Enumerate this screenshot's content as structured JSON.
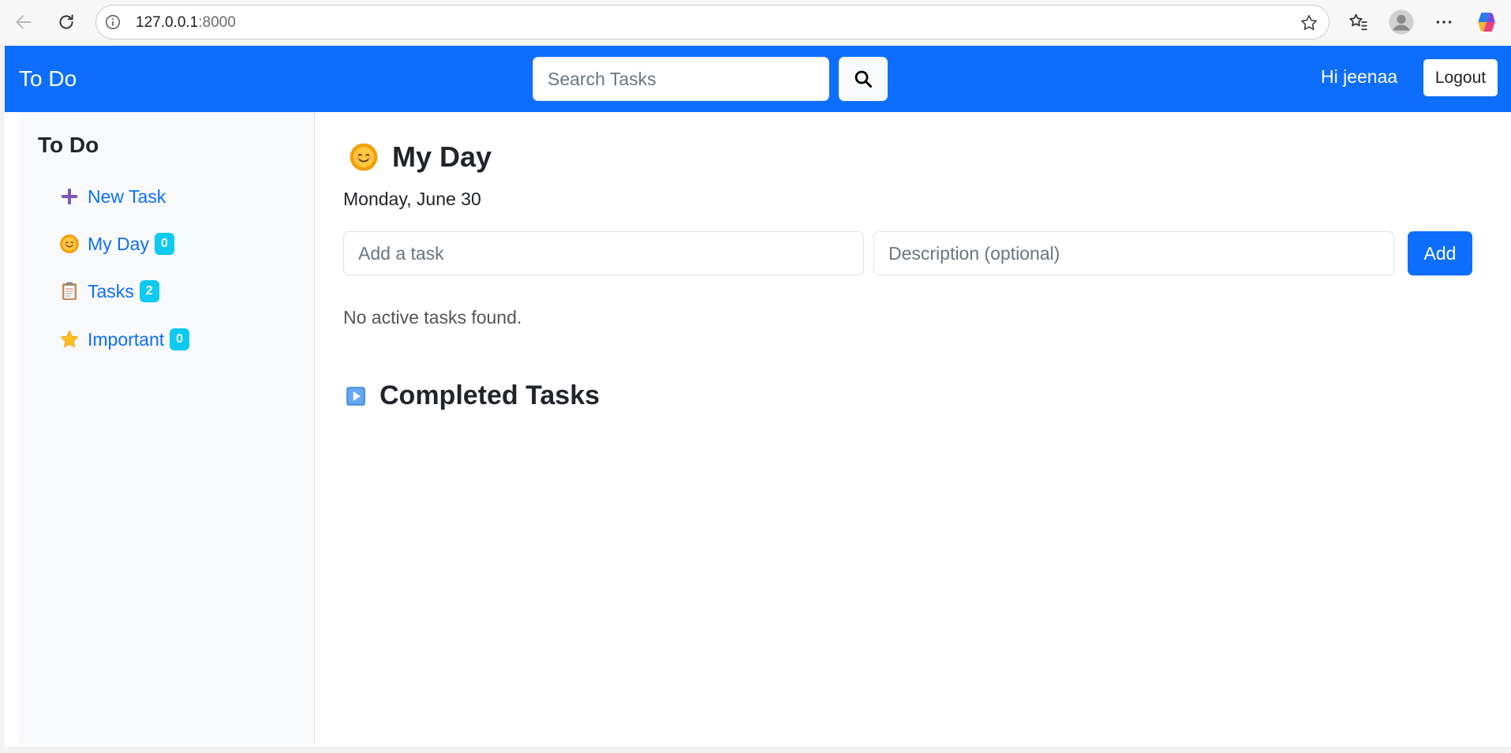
{
  "browser": {
    "url_host": "127.0.0.1",
    "url_port": ":8000",
    "icons": [
      "back-arrow-icon",
      "refresh-icon",
      "info-icon",
      "star-outline-icon",
      "favorites-icon",
      "profile-icon",
      "more-icon",
      "copilot-icon"
    ]
  },
  "navbar": {
    "brand": "To Do",
    "search_placeholder": "Search Tasks",
    "greeting": "Hi jeenaa",
    "logout_label": "Logout",
    "color": "#0d6efd"
  },
  "sidebar": {
    "title": "To Do",
    "items": [
      {
        "label": "New Task",
        "icon": "plus-icon",
        "badge": null
      },
      {
        "label": "My Day",
        "icon": "sun-face-icon",
        "badge": "0"
      },
      {
        "label": "Tasks",
        "icon": "clipboard-icon",
        "badge": "2"
      },
      {
        "label": "Important",
        "icon": "star-icon",
        "badge": "0"
      }
    ]
  },
  "main": {
    "title": "My Day",
    "date": "Monday, June 30",
    "task_placeholder": "Add a task",
    "description_placeholder": "Description (optional)",
    "add_label": "Add",
    "empty_message": "No active tasks found.",
    "completed_title": "Completed Tasks"
  },
  "colors": {
    "primary": "#0d6efd",
    "badge": "#0dcaf0",
    "sidebar_bg": "#f8f9fa"
  }
}
